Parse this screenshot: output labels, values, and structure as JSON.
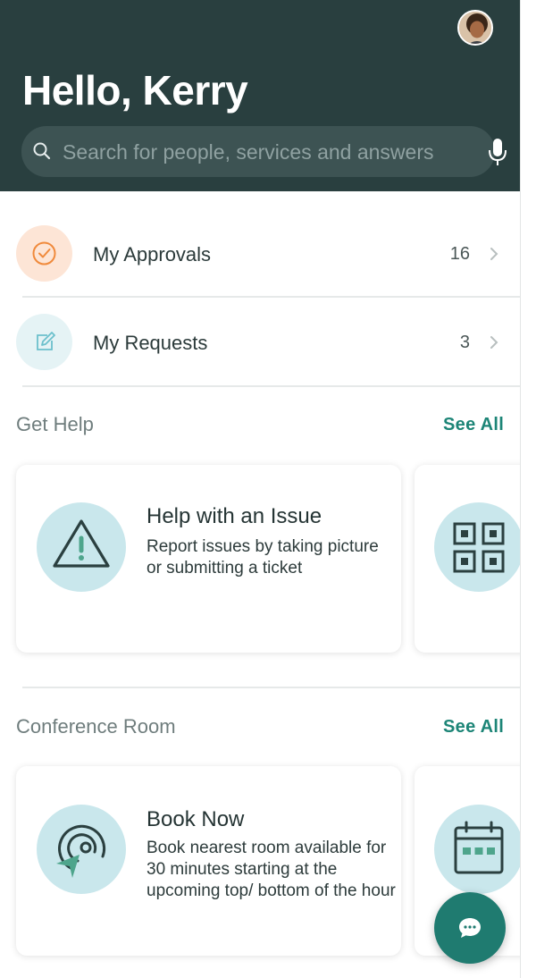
{
  "header": {
    "greeting": "Hello, Kerry",
    "search_placeholder": "Search for people, services and answers",
    "bg_color": "#293f3f"
  },
  "summary": {
    "approvals": {
      "label": "My Approvals",
      "count": "16",
      "icon": "check-circle-icon"
    },
    "requests": {
      "label": "My Requests",
      "count": "3",
      "icon": "edit-icon"
    }
  },
  "get_help": {
    "title": "Get Help",
    "see_all": "See All",
    "cards": [
      {
        "title": "Help with an Issue",
        "description": "Report issues by taking picture or submitting a ticket",
        "icon": "warning-icon"
      },
      {
        "icon": "qr-code-icon"
      }
    ]
  },
  "conference_room": {
    "title": "Conference Room",
    "see_all": "See All",
    "cards": [
      {
        "title": "Book Now",
        "description": "Book nearest room available for 30 minutes starting at the upcoming top/ bottom of the hour",
        "icon": "location-target-icon"
      },
      {
        "icon": "calendar-icon"
      }
    ]
  },
  "colors": {
    "accent": "#1d8577",
    "fab": "#1f7b70",
    "approvals_circle": "#fde5d6",
    "requests_circle": "#e5f3f5",
    "card_icon_circle": "#c9e7ec"
  }
}
